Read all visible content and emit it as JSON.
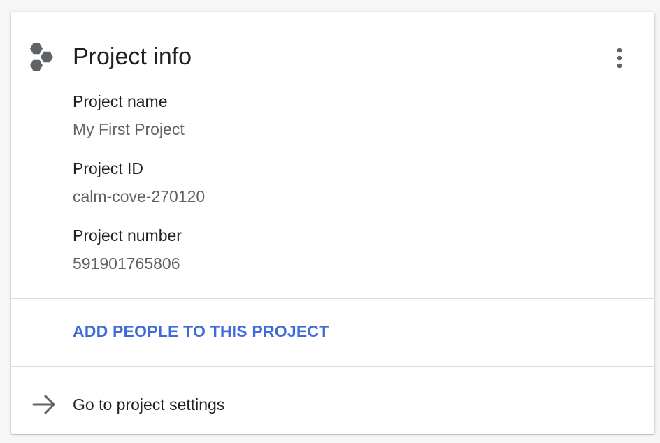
{
  "card": {
    "icon": "hexagons-icon",
    "title": "Project info",
    "menu_icon": "more-vert-icon",
    "fields": [
      {
        "label": "Project name",
        "value": "My First Project"
      },
      {
        "label": "Project ID",
        "value": "calm-cove-270120"
      },
      {
        "label": "Project number",
        "value": "591901765806"
      }
    ],
    "add_people_link": "ADD PEOPLE TO THIS PROJECT",
    "settings_link": {
      "icon": "arrow-right-icon",
      "label": "Go to project settings"
    }
  },
  "colors": {
    "link": "#3f6ad8",
    "text_primary": "#202124",
    "text_secondary": "#5f6368",
    "icon": "#5f6368",
    "divider": "#dadce0"
  }
}
